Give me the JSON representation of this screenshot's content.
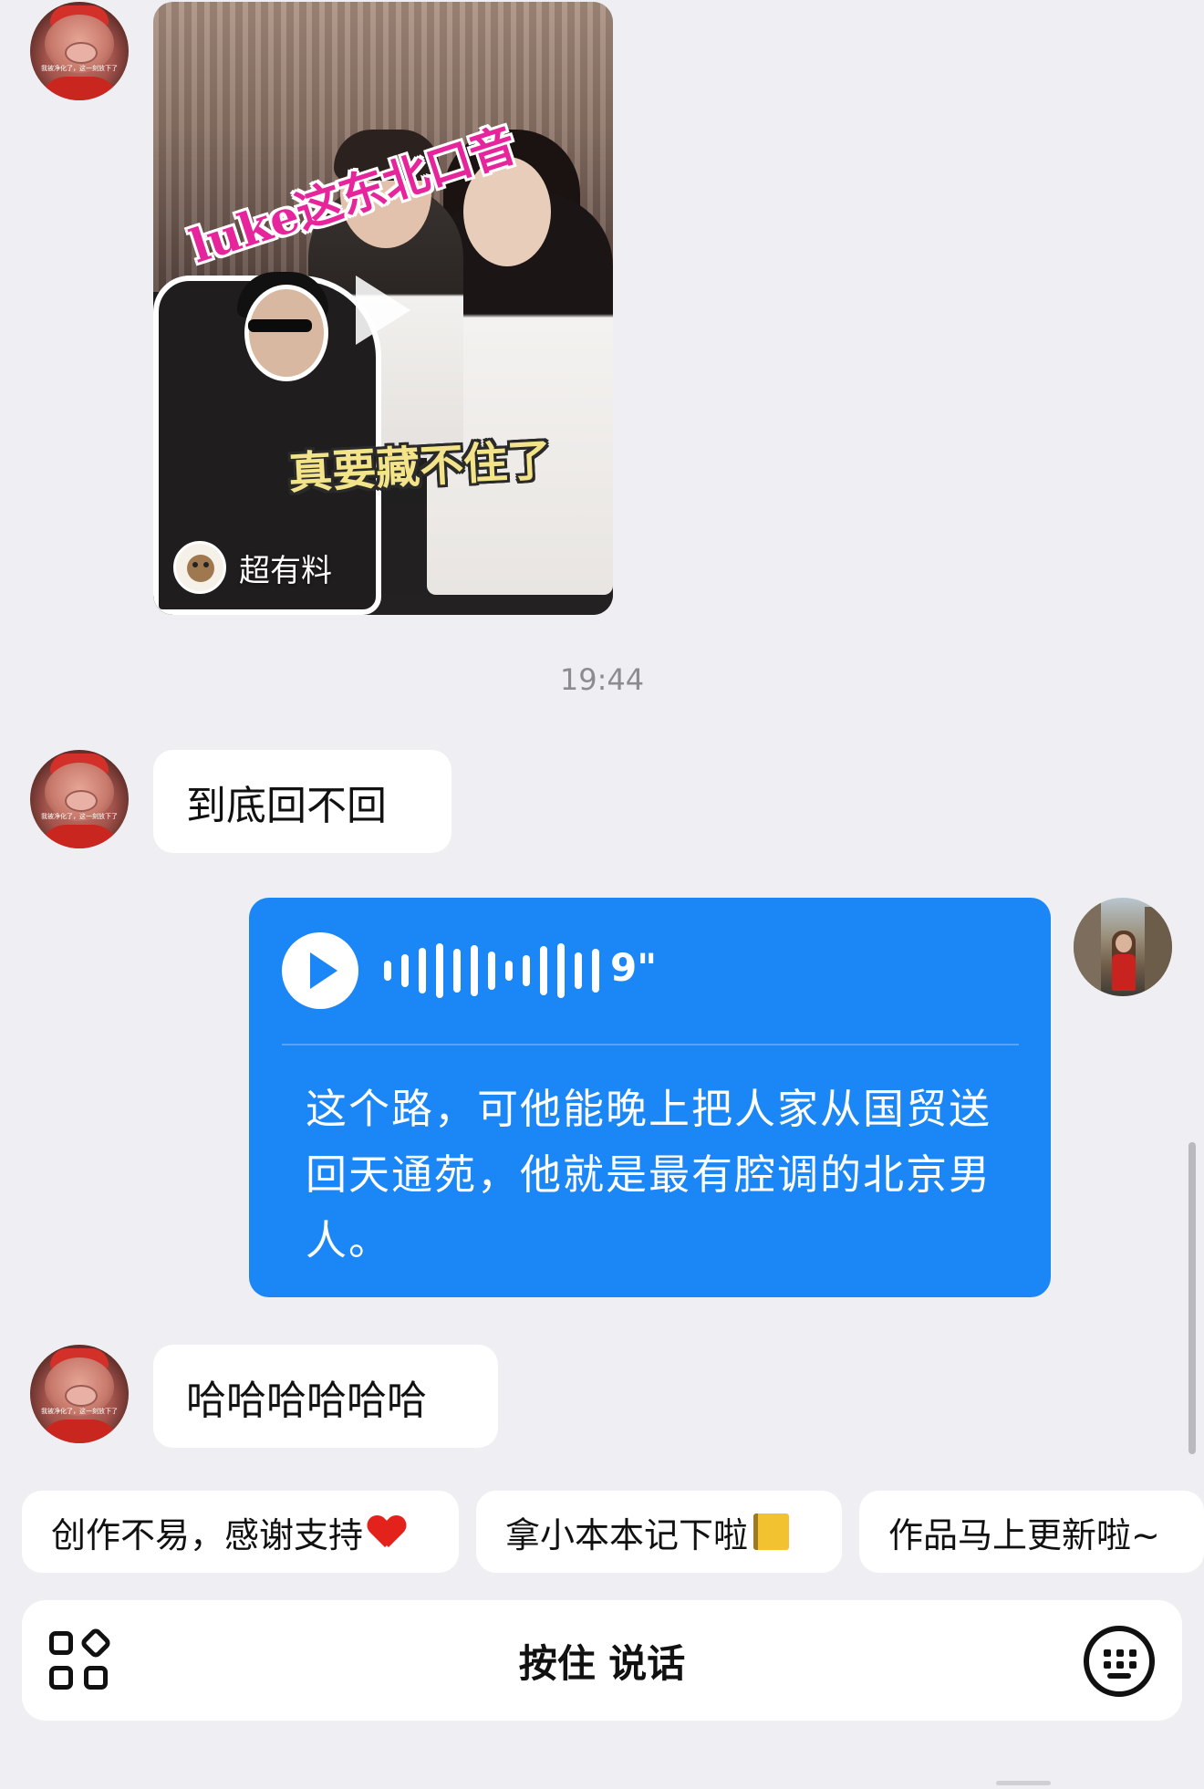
{
  "messages": {
    "video_card": {
      "title": "luke这东北口音",
      "subtitle": "真要藏不住了",
      "source": "超有料"
    },
    "timestamp": "19:44",
    "incoming_1": "到底回不回",
    "voice_message": {
      "duration": "9\"",
      "transcript": "这个路，可他能晚上把人家从国贸送回天通苑，他就是最有腔调的北京男人。"
    },
    "incoming_2": "哈哈哈哈哈哈",
    "contact_avatar_caption": "我被净化了，这一刻放下了"
  },
  "quick_replies": [
    {
      "label": "创作不易，感谢支持",
      "emoji": "heart"
    },
    {
      "label": "拿小本本记下啦",
      "emoji": "notebook"
    },
    {
      "label": "作品马上更新啦~",
      "emoji": ""
    }
  ],
  "input_bar": {
    "hold_to_talk": "按住 说话",
    "left_icon": "apps-icon",
    "right_icon": "keyboard-icon"
  },
  "colors": {
    "background": "#efeff3",
    "voice_bubble": "#1b86f5",
    "incoming_bubble": "#ffffff"
  }
}
